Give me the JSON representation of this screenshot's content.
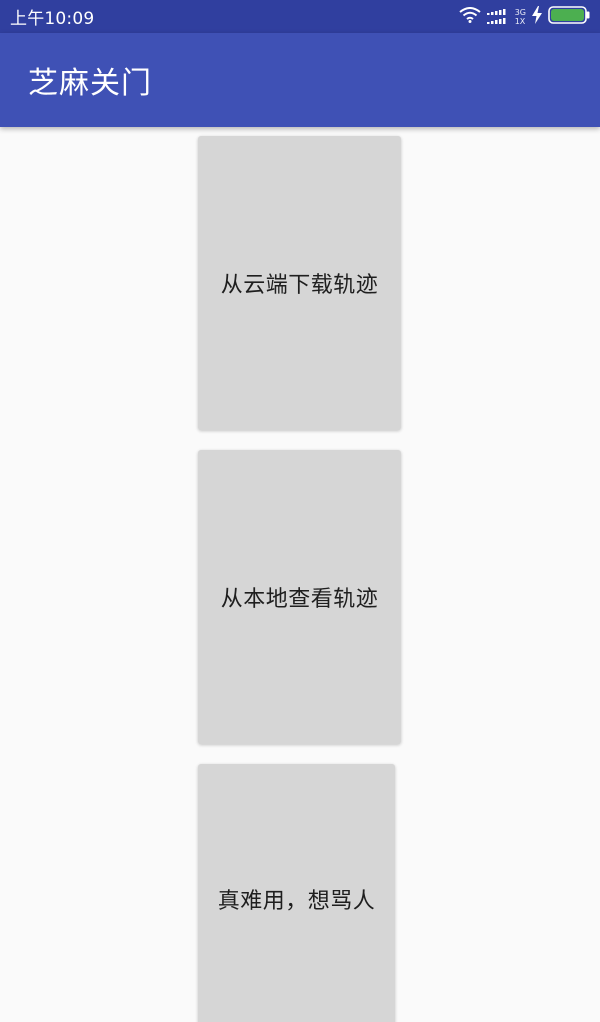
{
  "status_bar": {
    "time": "上午10:09",
    "network_top": "3G",
    "network_bottom": "1X",
    "icons": [
      "wifi-icon",
      "signal-icon",
      "charging-icon",
      "battery-icon"
    ],
    "battery_level": 1.0
  },
  "app_bar": {
    "title": "芝麻关门"
  },
  "buttons": [
    {
      "label": "从云端下载轨迹"
    },
    {
      "label": "从本地查看轨迹"
    },
    {
      "label": "真难用，想骂人"
    }
  ],
  "colors": {
    "status_bar": "#303f9f",
    "app_bar": "#3f51b5",
    "background": "#fafafa",
    "button": "#d6d6d6",
    "battery": "#4caf50"
  }
}
